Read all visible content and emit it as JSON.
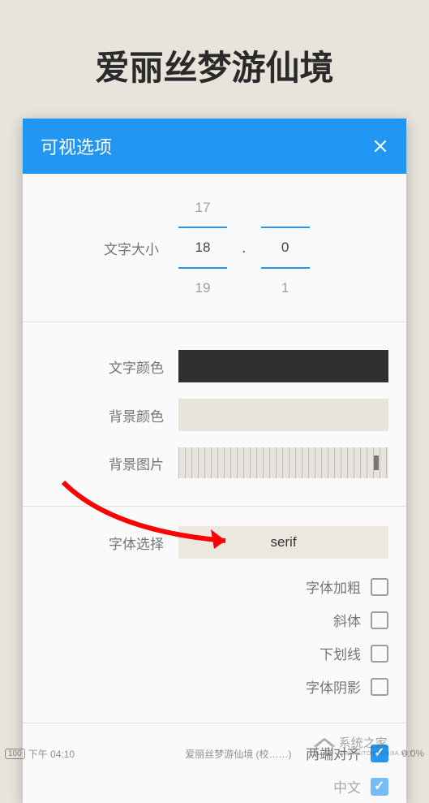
{
  "page_title": "爱丽丝梦游仙境",
  "dialog": {
    "title": "可视选项",
    "font_size": {
      "label": "文字大小",
      "prev_major": "17",
      "major": "18",
      "minor": "0",
      "next_major": "19",
      "next_minor": "1"
    },
    "text_color_label": "文字颜色",
    "bg_color_label": "背景颜色",
    "bg_image_label": "背景图片",
    "font_select": {
      "label": "字体选择",
      "value": "serif"
    },
    "checkboxes": {
      "bold": "字体加粗",
      "italic": "斜体",
      "underline": "下划线",
      "shadow": "字体阴影",
      "justify": "两端对齐",
      "chinese": "中文"
    }
  },
  "status": {
    "battery": "100",
    "time": "下午 04:10",
    "book": "爱丽丝梦游仙境 (校……)",
    "percent": "0.0%"
  },
  "watermark": {
    "text": "系统之家",
    "url": "WWW.XITONGZHIJIA.NET"
  }
}
